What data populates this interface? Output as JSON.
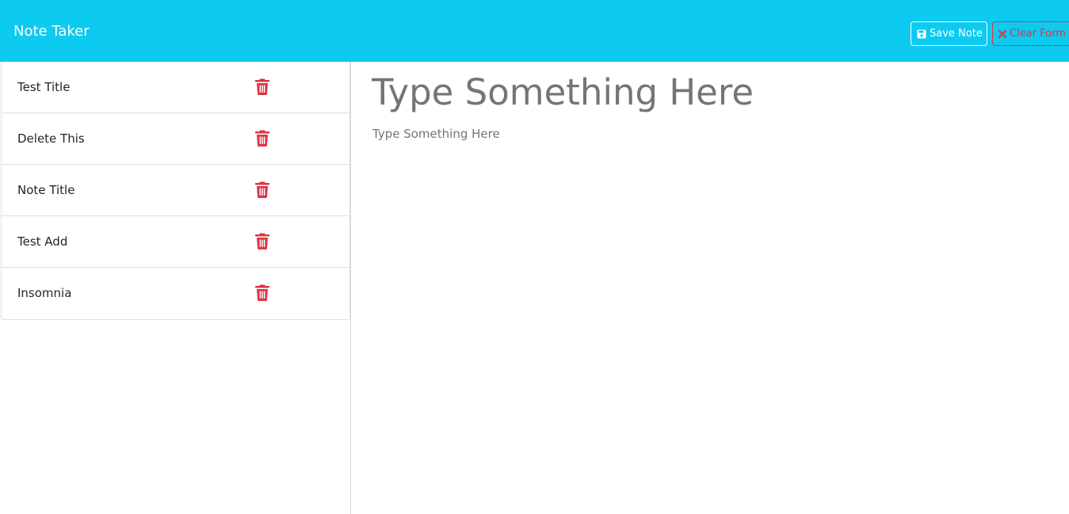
{
  "app": {
    "brand": "Note Taker"
  },
  "toolbar": {
    "save_label": "Save Note",
    "save_icon": "floppy-disk-icon",
    "clear_label": "Clear Form",
    "clear_icon": "x-icon"
  },
  "notes": [
    {
      "title": "Test Title",
      "icon": "trash-icon"
    },
    {
      "title": "Delete This",
      "icon": "trash-icon"
    },
    {
      "title": "Note Title",
      "icon": "trash-icon"
    },
    {
      "title": "Test Add",
      "icon": "trash-icon"
    },
    {
      "title": "Insomnia",
      "icon": "trash-icon"
    }
  ],
  "editor": {
    "title_placeholder": "Type Something Here",
    "body_placeholder": "Type Something Here"
  },
  "colors": {
    "navbar": "#0dcaf0",
    "danger": "#dc3545",
    "white": "#ffffff"
  }
}
